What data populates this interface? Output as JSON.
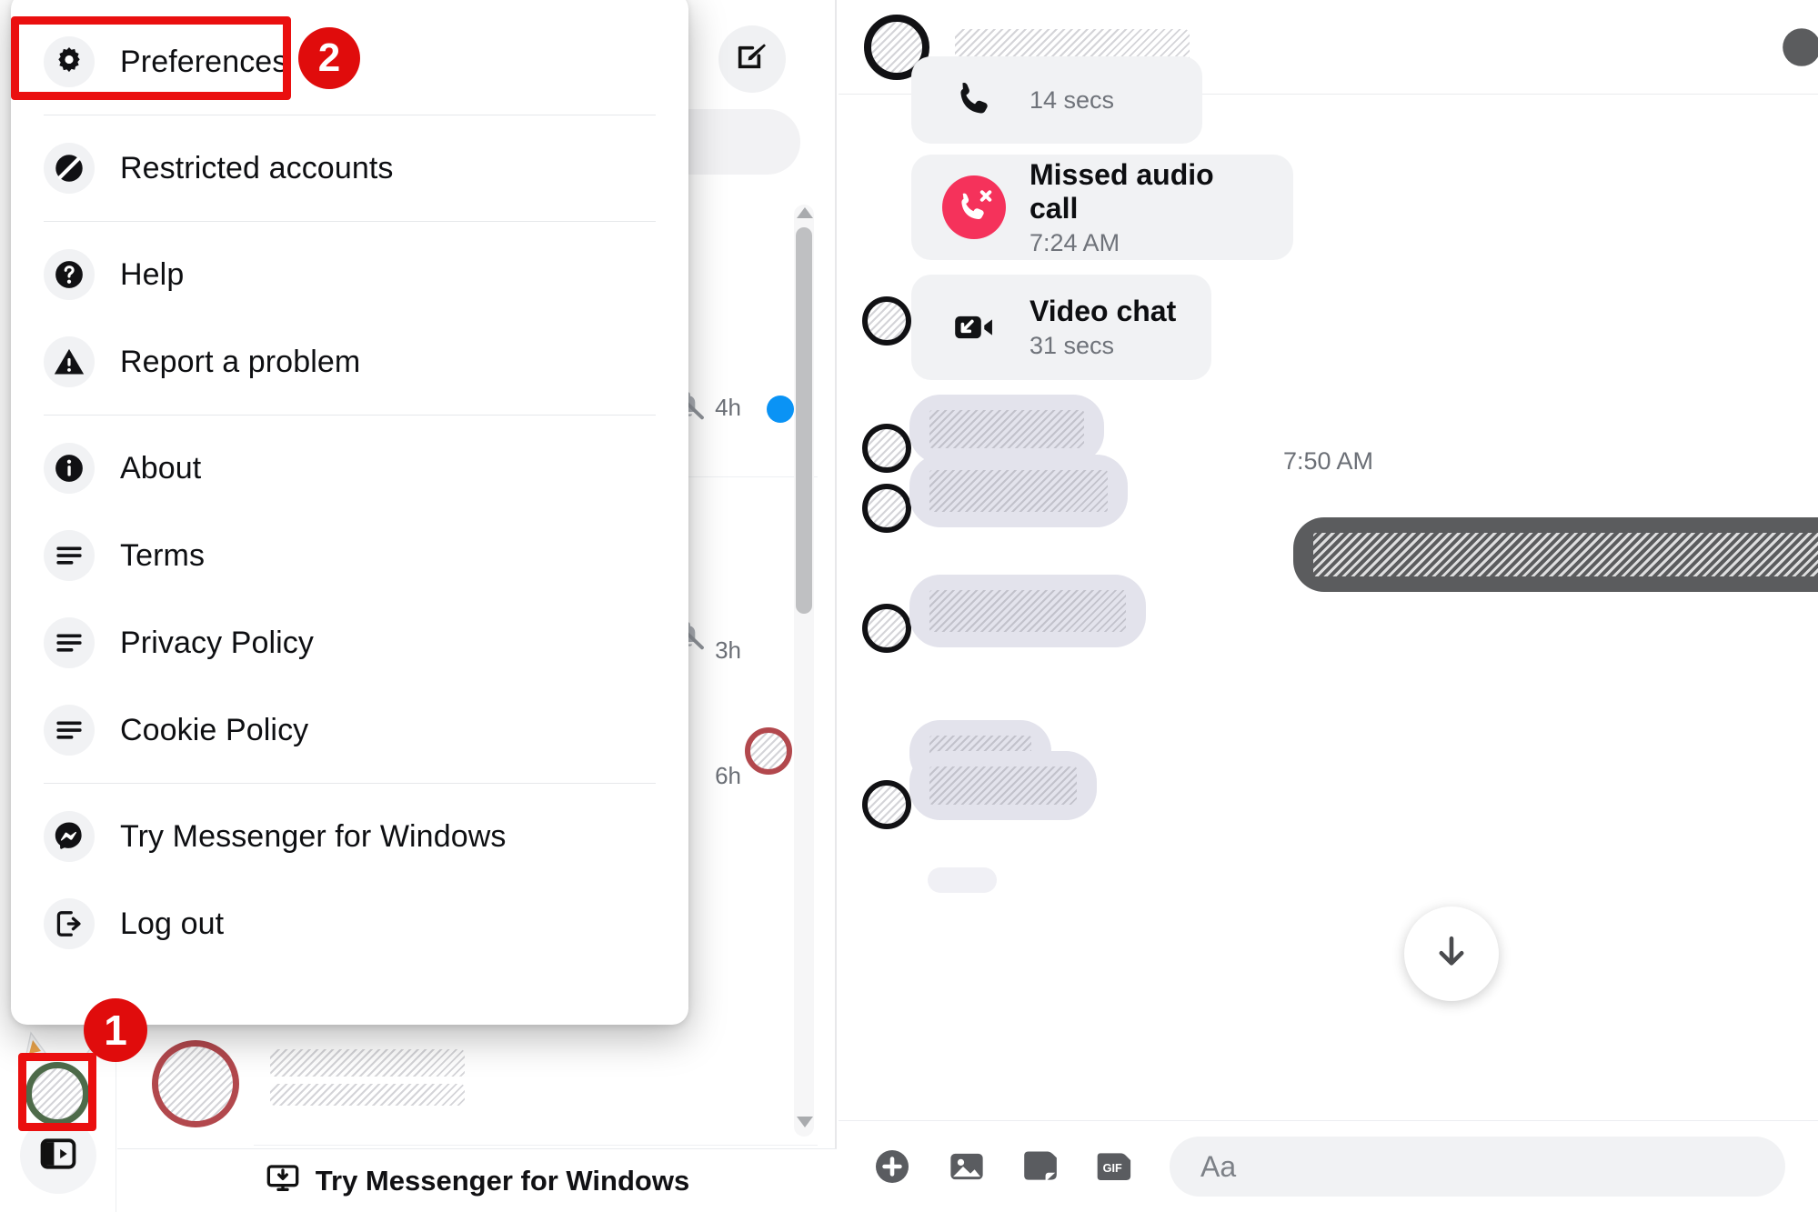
{
  "app": {
    "name": "Messenger"
  },
  "colors": {
    "annotation_red": "#e00c0c",
    "missed_call_red": "#f5325b",
    "unread_dot_blue": "#0a93f5",
    "incoming_bubble": "#e3e3ec",
    "outgoing_bubble": "#5b5c5e",
    "call_card_grey": "#f1f2f4"
  },
  "annotations": [
    {
      "number": "2",
      "target": "preferences-menu-item"
    },
    {
      "number": "1",
      "target": "profile-avatar-rail-button"
    }
  ],
  "chat_list": {
    "new_message_icon": "compose-icon",
    "search_placeholder": "",
    "rows": [
      {
        "name": "",
        "snippet": "",
        "time": "4h",
        "muted": true,
        "unread": true,
        "avatar_ring": "dark"
      },
      {
        "name": "",
        "snippet": "",
        "time": "3h",
        "muted": true,
        "unread": false,
        "avatar_ring": "dark"
      },
      {
        "name": "",
        "snippet": "",
        "time": "6h",
        "muted": false,
        "unread": false,
        "avatar_ring": "warm"
      }
    ],
    "footer_banner": {
      "icon": "monitor-download-icon",
      "label": "Try Messenger for Windows"
    },
    "scrollbar": {
      "present": true
    }
  },
  "rail": {
    "profile_button": "profile-avatar-button",
    "panel_button": "expand-sidebar-icon"
  },
  "menu": {
    "items": [
      {
        "label": "Preferences",
        "icon": "gear-icon",
        "separator_after": true,
        "highlighted": true
      },
      {
        "label": "Restricted accounts",
        "icon": "slashed-circle-icon",
        "separator_after": true,
        "highlighted": false
      },
      {
        "label": "Help",
        "icon": "question-mark-icon",
        "separator_after": false,
        "highlighted": false
      },
      {
        "label": "Report a problem",
        "icon": "warning-triangle-icon",
        "separator_after": true,
        "highlighted": false
      },
      {
        "label": "About",
        "icon": "info-icon",
        "separator_after": false,
        "highlighted": false
      },
      {
        "label": "Terms",
        "icon": "document-lines-icon",
        "separator_after": false,
        "highlighted": false
      },
      {
        "label": "Privacy Policy",
        "icon": "document-lines-icon",
        "separator_after": false,
        "highlighted": false
      },
      {
        "label": "Cookie Policy",
        "icon": "document-lines-icon",
        "separator_after": true,
        "highlighted": false
      },
      {
        "label": "Try Messenger for Windows",
        "icon": "messenger-logo-icon",
        "separator_after": false,
        "highlighted": false
      },
      {
        "label": "Log out",
        "icon": "logout-arrow-icon",
        "separator_after": false,
        "highlighted": false
      }
    ]
  },
  "thread": {
    "header": {
      "contact_name": "",
      "avatar": "redacted-avatar",
      "corner_icon": "info-icon"
    },
    "events": [
      {
        "kind": "call",
        "title": "",
        "meta": "14 secs",
        "icon": "phone-icon"
      },
      {
        "kind": "call",
        "title": "Missed audio call",
        "meta": "7:24 AM",
        "icon": "missed-call-icon"
      },
      {
        "kind": "call",
        "title": "Video chat",
        "meta": "31 secs",
        "icon": "video-camera-icon"
      },
      {
        "kind": "timestamp",
        "value": "7:50 AM"
      },
      {
        "kind": "message",
        "direction": "incoming",
        "text": ""
      },
      {
        "kind": "message",
        "direction": "incoming",
        "text": ""
      },
      {
        "kind": "message",
        "direction": "outgoing",
        "text": ""
      },
      {
        "kind": "message",
        "direction": "incoming",
        "text": ""
      },
      {
        "kind": "message",
        "direction": "incoming",
        "text": ""
      },
      {
        "kind": "message",
        "direction": "incoming",
        "text": ""
      }
    ],
    "scroll_to_bottom_icon": "down-arrow-icon"
  },
  "composer": {
    "actions": [
      {
        "icon": "plus-circle-icon",
        "label": ""
      },
      {
        "icon": "image-icon",
        "label": ""
      },
      {
        "icon": "sticker-icon",
        "label": ""
      },
      {
        "icon": "gif-icon",
        "label": "GIF"
      }
    ],
    "placeholder": "Aa",
    "value": ""
  }
}
